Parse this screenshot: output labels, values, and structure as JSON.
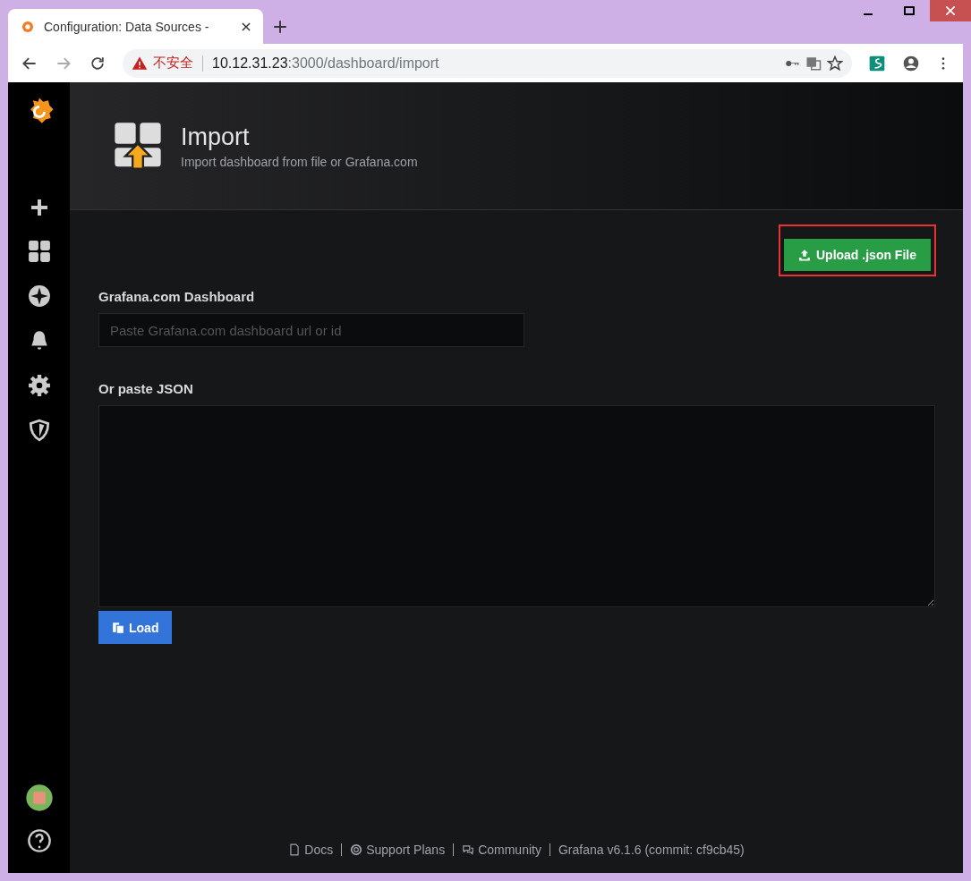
{
  "browser": {
    "tab_title": "Configuration: Data Sources - ",
    "security": "不安全",
    "url_host": "10.12.31.23",
    "url_path": ":3000/dashboard/import"
  },
  "header": {
    "title": "Import",
    "subtitle": "Import dashboard from file or Grafana.com"
  },
  "upload_button": {
    "label": "Upload .json File",
    "highlighted": true
  },
  "dashboard_field": {
    "label": "Grafana.com Dashboard",
    "placeholder": "Paste Grafana.com dashboard url or id"
  },
  "json_field": {
    "label": "Or paste JSON"
  },
  "load_button": {
    "label": "Load"
  },
  "footer": [
    {
      "kind": "docs",
      "label": "Docs"
    },
    {
      "kind": "support",
      "label": "Support Plans"
    },
    {
      "kind": "community",
      "label": "Community"
    },
    {
      "kind": "version",
      "label": "Grafana v6.1.6 (commit: cf9cb45)"
    }
  ]
}
